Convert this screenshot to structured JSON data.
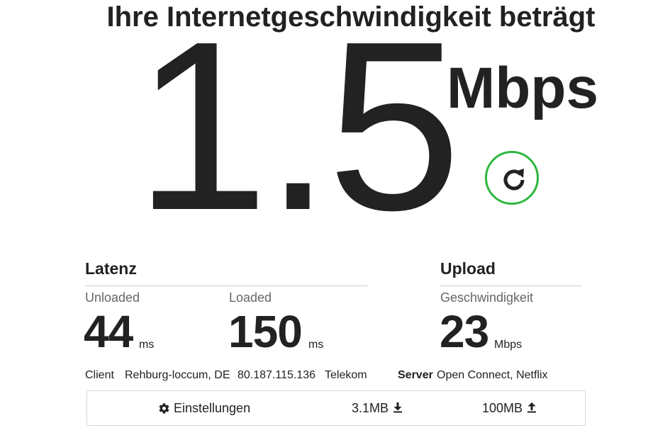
{
  "header": {
    "title": "Ihre Internetgeschwindigkeit beträgt"
  },
  "speed": {
    "value": "1.5",
    "unit": "Mbps"
  },
  "refresh": {
    "icon": "refresh-icon",
    "ring_color": "#2fb83f"
  },
  "latency": {
    "title": "Latenz",
    "unloaded": {
      "label": "Unloaded",
      "value": "44",
      "unit": "ms"
    },
    "loaded": {
      "label": "Loaded",
      "value": "150",
      "unit": "ms"
    }
  },
  "upload": {
    "title": "Upload",
    "speed": {
      "label": "Geschwindigkeit",
      "value": "23",
      "unit": "Mbps"
    }
  },
  "client": {
    "label": "Client",
    "location": "Rehburg-loccum, DE",
    "ip": "80.187.115.136",
    "isp": "Telekom"
  },
  "server": {
    "label": "Server",
    "value": "Open Connect, Netflix"
  },
  "settings_bar": {
    "settings_label": "Einstellungen",
    "download_size": "3.1MB",
    "upload_size": "100MB",
    "icons": [
      "gear-icon",
      "download-icon",
      "upload-icon"
    ]
  }
}
